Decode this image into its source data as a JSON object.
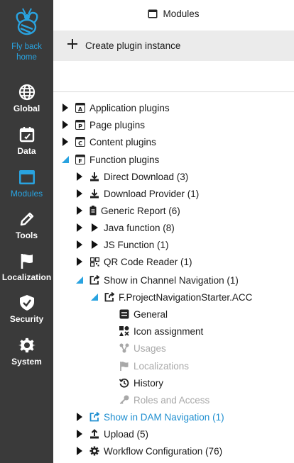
{
  "sidebar": {
    "logo_label": "Fly back home",
    "items": [
      {
        "label": "Global",
        "icon": "globe-icon"
      },
      {
        "label": "Data",
        "icon": "calendar-icon"
      },
      {
        "label": "Modules",
        "icon": "window-icon",
        "active": true
      },
      {
        "label": "Tools",
        "icon": "pencil-icon"
      },
      {
        "label": "Localization",
        "icon": "flag-icon"
      },
      {
        "label": "Security",
        "icon": "shield-icon"
      },
      {
        "label": "System",
        "icon": "gear-icon"
      }
    ]
  },
  "header": {
    "title": "Modules"
  },
  "toolbar": {
    "create_label": "Create plugin instance"
  },
  "tree": {
    "application_plugins": "Application plugins",
    "page_plugins": "Page plugins",
    "content_plugins": "Content plugins",
    "function_plugins": "Function plugins",
    "direct_download": "Direct Download (3)",
    "download_provider": "Download Provider (1)",
    "generic_report": "Generic Report (6)",
    "java_function": "Java function (8)",
    "js_function": "JS Function (1)",
    "qr_code_reader": "QR Code Reader (1)",
    "show_channel_nav": "Show in Channel Navigation (1)",
    "project_nav_starter": "F.ProjectNavigationStarter.ACC",
    "general": "General",
    "icon_assignment": "Icon assignment",
    "usages": "Usages",
    "localizations": "Localizations",
    "history": "History",
    "roles_access": "Roles and Access",
    "show_dam_nav": "Show in DAM Navigation (1)",
    "upload": "Upload (5)",
    "workflow_config": "Workflow Configuration (76)"
  },
  "colors": {
    "sidebar_bg": "#3a3a3a",
    "accent": "#29a3e0",
    "link": "#1f8fd0",
    "disabled": "#a8a8a8",
    "toolbar_bg": "#ebebeb"
  }
}
